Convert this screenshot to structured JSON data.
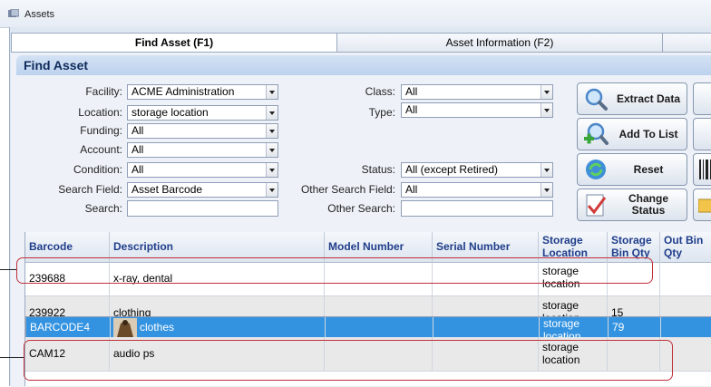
{
  "window": {
    "title": "Assets"
  },
  "tabs": [
    {
      "label": "Find Asset (F1)",
      "active": true
    },
    {
      "label": "Asset Information (F2)",
      "active": false
    }
  ],
  "panel": {
    "title": "Find Asset"
  },
  "filters": {
    "facility": {
      "label": "Facility:",
      "value": "ACME Administration"
    },
    "location": {
      "label": "Location:",
      "value": "storage location"
    },
    "funding": {
      "label": "Funding:",
      "value": "All"
    },
    "account": {
      "label": "Account:",
      "value": "All"
    },
    "condition": {
      "label": "Condition:",
      "value": "All"
    },
    "search_field": {
      "label": "Search Field:",
      "value": "Asset Barcode"
    },
    "search": {
      "label": "Search:",
      "value": ""
    },
    "class": {
      "label": "Class:",
      "value": "All"
    },
    "type": {
      "label": "Type:",
      "value": "All"
    },
    "status": {
      "label": "Status:",
      "value": "All  (except Retired)"
    },
    "other_search_field": {
      "label": "Other Search Field:",
      "value": "All"
    },
    "other_search": {
      "label": "Other Search:",
      "value": ""
    }
  },
  "buttons": {
    "extract": {
      "label": "Extract Data",
      "icon": "magnifier-icon"
    },
    "add_to_list": {
      "label": "Add To List",
      "icon": "magnifier-plus-icon"
    },
    "reset": {
      "label": "Reset",
      "icon": "refresh-icon"
    },
    "change_status": {
      "label": "Change\nStatus",
      "icon": "checkmark-document-icon"
    }
  },
  "table": {
    "columns": {
      "barcode": "Barcode",
      "description": "Description",
      "model": "Model Number",
      "serial": "Serial Number",
      "storage_location": "Storage Location",
      "storage_bin_qty": "Storage Bin Qty",
      "out_bin_qty": "Out Bin Qty"
    },
    "rows": [
      {
        "barcode": "239688",
        "description": "x-ray, dental",
        "model": "",
        "serial": "",
        "storage_location": "storage location",
        "storage_bin_qty": "",
        "out_bin_qty": ""
      },
      {
        "barcode": "239922",
        "description": "clothing",
        "model": "",
        "serial": "",
        "storage_location": "storage location",
        "storage_bin_qty": "15",
        "out_bin_qty": ""
      },
      {
        "barcode": "BARCODE4",
        "description": "clothes",
        "model": "",
        "serial": "",
        "storage_location": "storage location",
        "storage_bin_qty": "79",
        "out_bin_qty": "",
        "selected": true,
        "has_thumbnail": true
      },
      {
        "barcode": "CAM12",
        "description": "audio ps",
        "model": "",
        "serial": "",
        "storage_location": "storage location",
        "storage_bin_qty": "",
        "out_bin_qty": ""
      }
    ]
  },
  "colors": {
    "selected_row": "#3393e1",
    "highlight": "#c0303a",
    "header_text": "#1f3d8a"
  }
}
